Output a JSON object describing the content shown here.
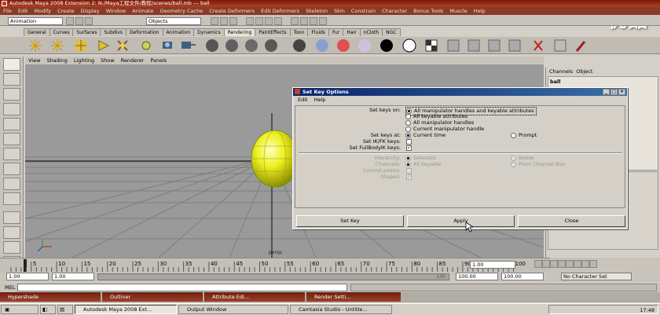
{
  "window": {
    "title": "Autodesk Maya 2008 Extension 2: N:/Maya工程文件/教程/scenes/ball.mb  ---  ball"
  },
  "watermark": "优酷",
  "menubar": [
    "File",
    "Edit",
    "Modify",
    "Create",
    "Display",
    "Window",
    "Animate",
    "Geometry Cache",
    "Create Deformers",
    "Edit Deformers",
    "Skeleton",
    "Skin",
    "Constrain",
    "Character",
    "Bonus Tools",
    "Muscle",
    "Help"
  ],
  "statusline": {
    "mode": "Animation",
    "selection_mode": "Objects"
  },
  "shelf_tabs": [
    "General",
    "Curves",
    "Surfaces",
    "Subdivs",
    "Deformation",
    "Animation",
    "Dynamics",
    "Rendering",
    "PaintEffects",
    "Toon",
    "Fluids",
    "Fur",
    "Hair",
    "nCloth",
    "NGC"
  ],
  "active_shelf_tab": "Rendering",
  "viewport_menu": [
    "View",
    "Shading",
    "Lighting",
    "Show",
    "Renderer",
    "Panels"
  ],
  "viewport": {
    "camera_label": "persp"
  },
  "channel_box": {
    "menu": [
      "Channels",
      "Object"
    ],
    "object_name": "ball"
  },
  "timeline": {
    "ticks": [
      "5",
      "10",
      "15",
      "20",
      "25",
      "30",
      "35",
      "40",
      "45",
      "50",
      "55",
      "60",
      "65",
      "70",
      "75",
      "80",
      "85",
      "90",
      "95",
      "100"
    ],
    "current_frame": "1.00"
  },
  "range": {
    "start": "1.00",
    "playback_start": "1.00",
    "range_label": "100",
    "playback_end": "100.00",
    "end": "100.00",
    "character_set": "No Character Set"
  },
  "mel_label": "MEL",
  "minimized_windows": [
    "Hypershade",
    "Outliner",
    "Attribute Edi...",
    "Render Setti..."
  ],
  "taskbar": {
    "items": [
      "Autodesk Maya 2008 Ext...",
      "Output Window",
      "Camtasia Studio - Untitle..."
    ],
    "clock": "17:48"
  },
  "dialog": {
    "title": "Set Key Options",
    "menu": [
      "Edit",
      "Help"
    ],
    "set_keys_on_label": "Set keys on:",
    "set_keys_on_options": [
      "All manipulator handles and keyable attributes",
      "All keyable attributes",
      "All manipulator handles",
      "Current manipulator handle"
    ],
    "set_keys_at_label": "Set keys at:",
    "set_keys_at_options": [
      "Current time",
      "Prompt"
    ],
    "set_ikfk_label": "Set IK/FK keys:",
    "set_fullbodyik_label": "Set FullBodyIK keys:",
    "hierarchy_label": "Hierarchy:",
    "hierarchy_options": [
      "Selected",
      "Below"
    ],
    "channels_label": "Channels:",
    "channels_options": [
      "All keyable",
      "From Channel Box"
    ],
    "control_points_label": "Control points:",
    "shapes_label": "Shapes:",
    "buttons": [
      "Set Key",
      "Apply",
      "Close"
    ]
  }
}
